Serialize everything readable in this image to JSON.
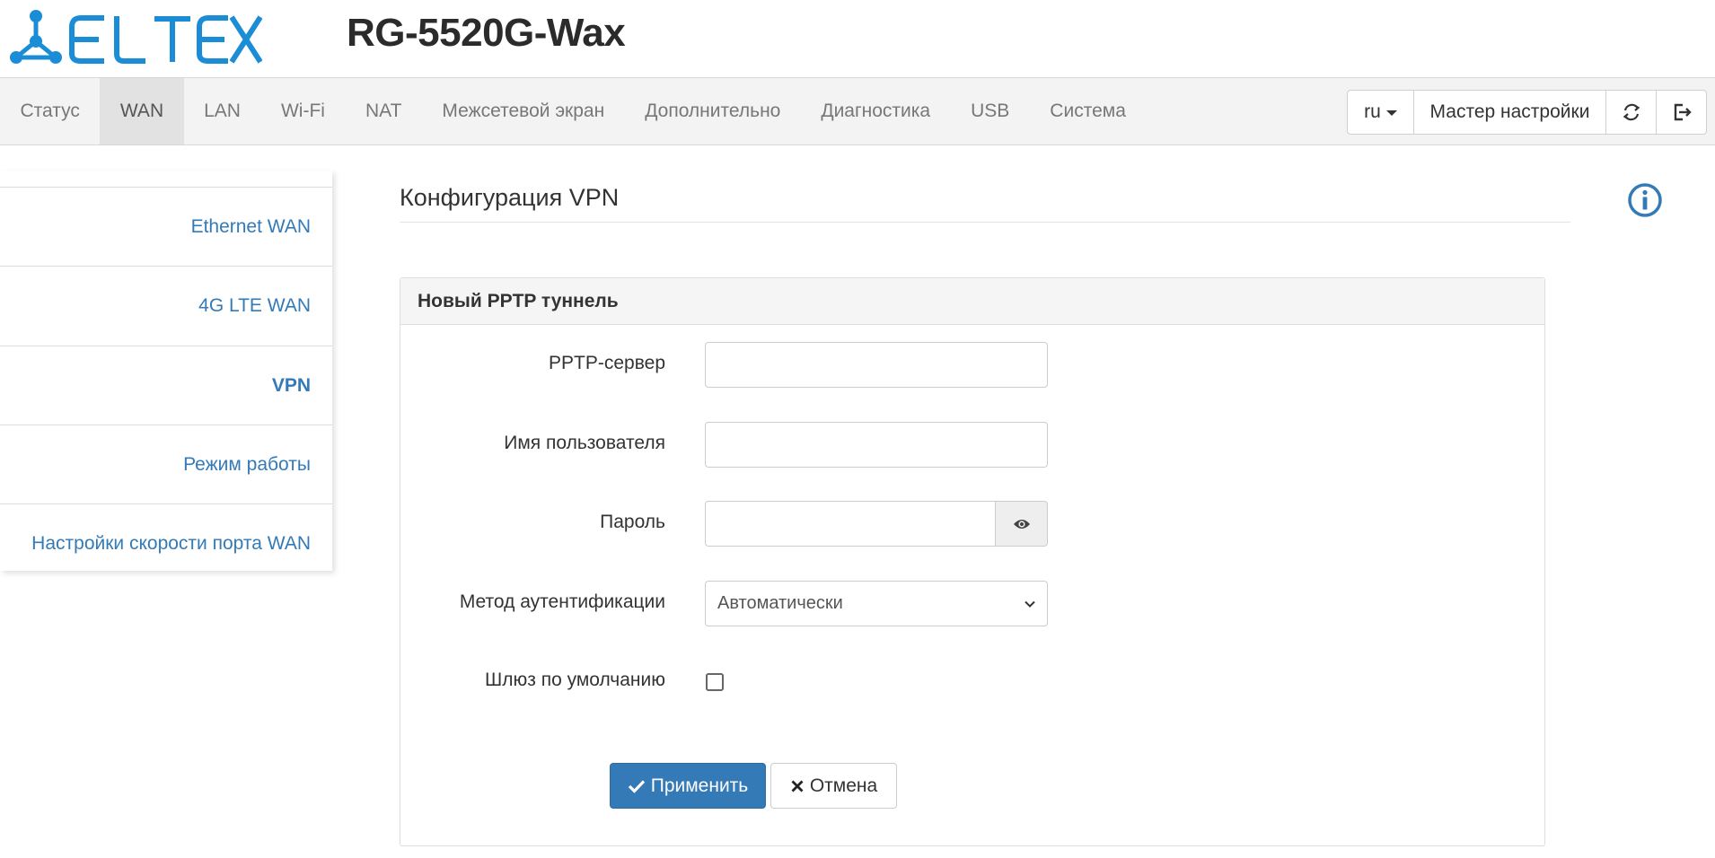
{
  "header": {
    "brand": "ELTEX",
    "model": "RG-5520G-Wax",
    "brand_color": "#1a8dd6"
  },
  "nav": {
    "items": [
      {
        "label": "Статус"
      },
      {
        "label": "WAN"
      },
      {
        "label": "LAN"
      },
      {
        "label": "Wi-Fi"
      },
      {
        "label": "NAT"
      },
      {
        "label": "Межсетевой экран"
      },
      {
        "label": "Дополнительно"
      },
      {
        "label": "Диагностика"
      },
      {
        "label": "USB"
      },
      {
        "label": "Система"
      }
    ],
    "active": "WAN",
    "language": "ru",
    "wizard_label": "Мастер настройки",
    "refresh_icon": "refresh-icon",
    "logout_icon": "logout-icon"
  },
  "sidebar": {
    "items": [
      {
        "label": "Ethernet WAN"
      },
      {
        "label": "4G LTE WAN"
      },
      {
        "label": "VPN"
      },
      {
        "label": "Режим работы"
      },
      {
        "label": "Настройки скорости порта WAN"
      }
    ],
    "active": "VPN"
  },
  "main": {
    "title": "Конфигурация VPN",
    "info_icon": "info-icon",
    "panel": {
      "heading": "Новый PPTP туннель",
      "fields": {
        "server_label": "PPTP-сервер",
        "server_value": "",
        "username_label": "Имя пользователя",
        "username_value": "",
        "password_label": "Пароль",
        "password_value": "",
        "auth_label": "Метод аутентификации",
        "auth_value": "Автоматически",
        "gateway_label": "Шлюз по умолчанию",
        "gateway_checked": false
      },
      "apply_label": "Применить",
      "cancel_label": "Отмена"
    }
  },
  "colors": {
    "link": "#337ab7",
    "primary": "#337ab7",
    "navbar_bg": "#f3f3f3"
  }
}
